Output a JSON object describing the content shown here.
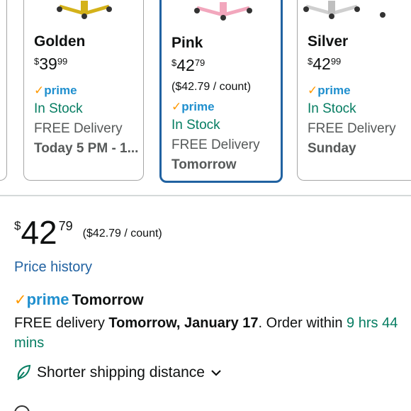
{
  "variants": [
    {
      "name": "Golden",
      "currency": "$",
      "whole": "39",
      "fraction": "99",
      "unit_price": "",
      "prime": "prime",
      "stock": "In Stock",
      "delivery": "FREE Delivery",
      "when": "Today 5 PM - 1...",
      "selected": false,
      "color": "#d4b21a"
    },
    {
      "name": "Pink",
      "currency": "$",
      "whole": "42",
      "fraction": "79",
      "unit_price": "($42.79 / count)",
      "prime": "prime",
      "stock": "In Stock",
      "delivery": "FREE Delivery",
      "when": "Tomorrow",
      "selected": true,
      "color": "#f2a7bd"
    },
    {
      "name": "Silver",
      "currency": "$",
      "whole": "42",
      "fraction": "99",
      "unit_price": "",
      "prime": "prime",
      "stock": "In Stock",
      "delivery": "FREE Delivery",
      "when": "Sunday",
      "selected": false,
      "color": "#d9d9d9"
    }
  ],
  "price": {
    "currency": "$",
    "whole": "42",
    "fraction": "79",
    "unit_price": "($42.79 / count)"
  },
  "price_history": "Price history",
  "prime_badge": {
    "word": "prime",
    "label": "Tomorrow"
  },
  "delivery": {
    "prefix": "FREE delivery",
    "date": "Tomorrow, January 17",
    "middle": ". Order within",
    "countdown": "9 hrs 44 mins"
  },
  "shipping": {
    "label": "Shorter shipping distance",
    "icon": "leaf-icon"
  },
  "colors": {
    "link": "#2162a1",
    "prime": "#1f8fce",
    "stock": "#067d62",
    "check": "#ff9900",
    "selected_border": "#2162a1"
  }
}
